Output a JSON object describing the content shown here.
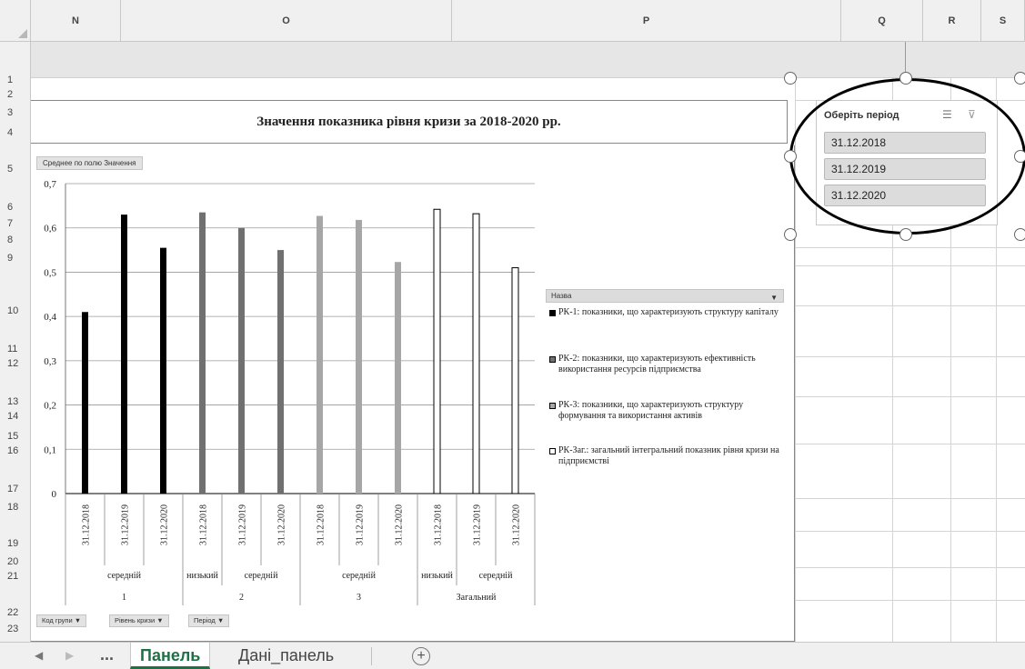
{
  "columns": [
    "N",
    "O",
    "P",
    "Q",
    "R",
    "S"
  ],
  "rows": [
    "1",
    "2",
    "3",
    "4",
    "5",
    "6",
    "7",
    "8",
    "9",
    "10",
    "11",
    "12",
    "13",
    "14",
    "15",
    "16",
    "17",
    "18",
    "19",
    "20",
    "21",
    "22",
    "23"
  ],
  "report_title": "Значення показника рівня кризи за 2018-2020 рр.",
  "value_field_button": "Среднее по полю Значення",
  "axis_field_buttons": [
    "Код групи ▼",
    "Рівень кризи ▼",
    "Період ▼"
  ],
  "legend": {
    "title": "Назва",
    "dropdown_icon": "▼",
    "items": [
      {
        "label": "РК-1: показники, що характеризують структуру капіталу",
        "color": "#000000"
      },
      {
        "label": "РК-2: показники, що характеризують ефективність використання ресурсів підприємства",
        "color": "#707070"
      },
      {
        "label": "РК-3: показники, що характеризують структуру формування та використання активів",
        "color": "#a6a6a6"
      },
      {
        "label": "РК-Заг.: загальний інтегральний показник рівня кризи на підприємстві",
        "color": "#ffffff"
      }
    ]
  },
  "chart_data": {
    "type": "bar",
    "ylim": [
      0,
      0.7
    ],
    "y_ticks": [
      "0",
      "0,1",
      "0,2",
      "0,3",
      "0,4",
      "0,5",
      "0,6",
      "0,7"
    ],
    "grid": true,
    "legend_position": "right",
    "categories": [
      "31.12.2018",
      "31.12.2019",
      "31.12.2020",
      "31.12.2018",
      "31.12.2019",
      "31.12.2020",
      "31.12.2018",
      "31.12.2019",
      "31.12.2020",
      "31.12.2018",
      "31.12.2019",
      "31.12.2020"
    ],
    "values": [
      0.41,
      0.63,
      0.555,
      0.635,
      0.6,
      0.55,
      0.627,
      0.618,
      0.523,
      0.642,
      0.632,
      0.51
    ],
    "bar_groups": [
      0,
      0,
      0,
      1,
      1,
      1,
      2,
      2,
      2,
      3,
      3,
      3
    ],
    "level_labels": [
      {
        "text": "середній",
        "from": 0,
        "to": 2
      },
      {
        "text": "низький",
        "from": 3,
        "to": 3
      },
      {
        "text": "середній",
        "from": 4,
        "to": 5
      },
      {
        "text": "середній",
        "from": 6,
        "to": 8
      },
      {
        "text": "низький",
        "from": 9,
        "to": 9
      },
      {
        "text": "середній",
        "from": 10,
        "to": 11
      }
    ],
    "group_labels": [
      {
        "text": "1",
        "from": 0,
        "to": 2
      },
      {
        "text": "2",
        "from": 3,
        "to": 5
      },
      {
        "text": "3",
        "from": 6,
        "to": 8
      },
      {
        "text": "Загальний",
        "from": 9,
        "to": 11
      }
    ]
  },
  "slicer": {
    "title": "Оберіть період",
    "multiselect_icon": "☰",
    "clear_filter_icon": "⊽",
    "items": [
      "31.12.2018",
      "31.12.2019",
      "31.12.2020"
    ]
  },
  "tabs": {
    "prev_icon": "◀",
    "next_icon": "▶",
    "more": "...",
    "active": "Панель",
    "other": "Дані_панель",
    "add_icon": "+"
  }
}
